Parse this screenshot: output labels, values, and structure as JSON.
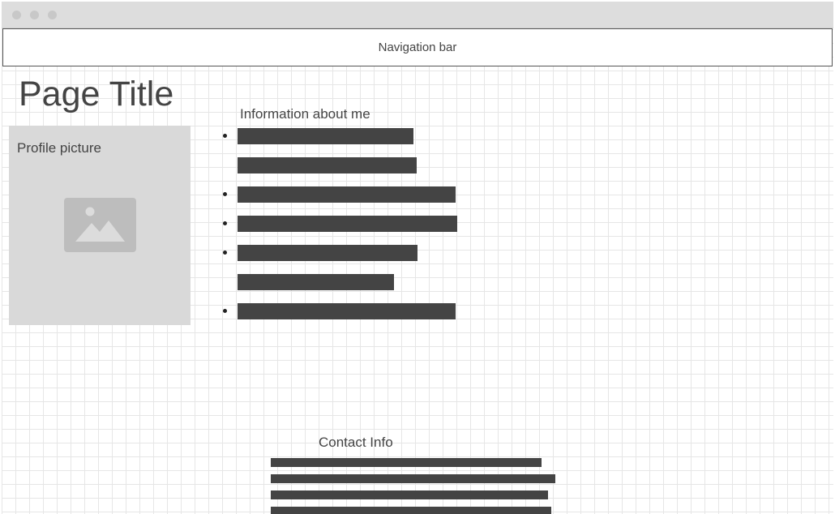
{
  "window": {
    "controls": [
      "close-dot",
      "minimize-dot",
      "maximize-dot"
    ]
  },
  "navbar": {
    "label": "Navigation bar"
  },
  "page": {
    "title": "Page Title"
  },
  "profile": {
    "label": "Profile picture",
    "icon": "image-placeholder-icon"
  },
  "info": {
    "heading": "Information about me",
    "items": [
      {
        "bullet": true
      },
      {
        "bullet": false
      },
      {
        "bullet": true
      },
      {
        "bullet": true
      },
      {
        "bullet": true
      },
      {
        "bullet": false
      },
      {
        "bullet": true
      }
    ]
  },
  "contact": {
    "heading": "Contact Info",
    "line_count": 4
  },
  "colors": {
    "titlebar": "#dddddd",
    "grid": "#e6e6e6",
    "text": "#444444",
    "placeholder_bar": "#444444",
    "profile_bg": "#d9d9d9",
    "icon": "#bdbdbd"
  }
}
